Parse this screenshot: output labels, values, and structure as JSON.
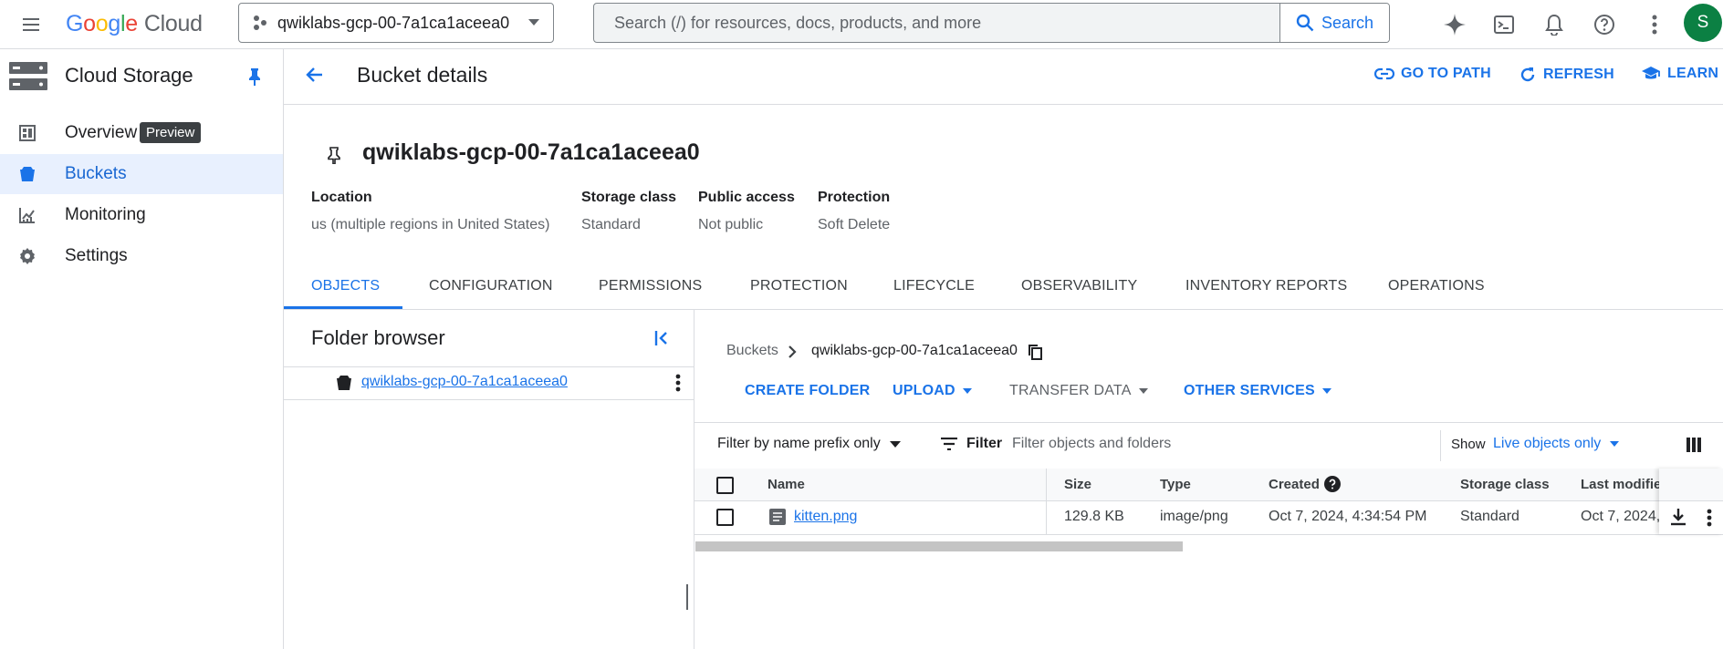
{
  "header": {
    "logo_google": "Google",
    "logo_cloud": "Cloud",
    "project": "qwiklabs-gcp-00-7a1ca1aceea0",
    "search_placeholder": "Search (/) for resources, docs, products, and more",
    "search_button": "Search",
    "avatar_initial": "S"
  },
  "sidebar": {
    "title": "Cloud Storage",
    "items": [
      {
        "label": "Overview",
        "badge": "Preview",
        "icon": "dashboard-icon"
      },
      {
        "label": "Buckets",
        "icon": "bucket-icon",
        "active": true
      },
      {
        "label": "Monitoring",
        "icon": "monitoring-chart-icon"
      },
      {
        "label": "Settings",
        "icon": "gear-icon"
      }
    ]
  },
  "page": {
    "title": "Bucket details",
    "actions": {
      "go_to_path": "GO TO PATH",
      "refresh": "REFRESH",
      "learn": "LEARN"
    }
  },
  "bucket": {
    "name": "qwiklabs-gcp-00-7a1ca1aceea0",
    "meta": [
      {
        "label": "Location",
        "value": "us (multiple regions in United States)"
      },
      {
        "label": "Storage class",
        "value": "Standard"
      },
      {
        "label": "Public access",
        "value": "Not public"
      },
      {
        "label": "Protection",
        "value": "Soft Delete"
      }
    ]
  },
  "tabs": [
    "OBJECTS",
    "CONFIGURATION",
    "PERMISSIONS",
    "PROTECTION",
    "LIFECYCLE",
    "OBSERVABILITY",
    "INVENTORY REPORTS",
    "OPERATIONS"
  ],
  "folder_browser": {
    "title": "Folder browser",
    "bucket": "qwiklabs-gcp-00-7a1ca1aceea0"
  },
  "breadcrumb": {
    "root": "Buckets",
    "current": "qwiklabs-gcp-00-7a1ca1aceea0"
  },
  "object_actions": {
    "create_folder": "CREATE FOLDER",
    "upload": "UPLOAD",
    "transfer_data": "TRANSFER DATA",
    "other_services": "OTHER SERVICES"
  },
  "filter_bar": {
    "prefix": "Filter by name prefix only",
    "filter_label": "Filter",
    "filter_placeholder": "Filter objects and folders",
    "show_label": "Show",
    "show_value": "Live objects only"
  },
  "table": {
    "headers": {
      "name": "Name",
      "size": "Size",
      "type": "Type",
      "created": "Created",
      "storage_class": "Storage class",
      "last_modified": "Last modified"
    },
    "rows": [
      {
        "name": "kitten.png",
        "size": "129.8 KB",
        "type": "image/png",
        "created": "Oct 7, 2024, 4:34:54 PM",
        "storage_class": "Standard",
        "last_modified": "Oct 7, 2024,"
      }
    ]
  },
  "colors": {
    "accent": "#1a73e8",
    "active_bg": "#e8f0fe",
    "avatar": "#0b8043"
  }
}
